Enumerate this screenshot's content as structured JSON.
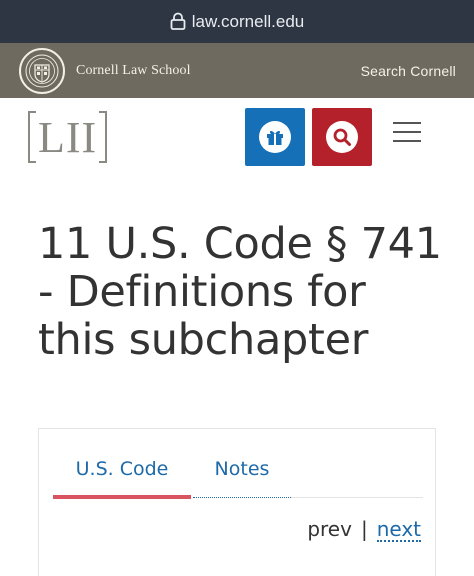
{
  "browser": {
    "url": "law.cornell.edu",
    "lock_icon": "lock-icon"
  },
  "cornell_bar": {
    "school_name": "Cornell Law School",
    "search_label": "Search Cornell",
    "background": "#6f6a5f"
  },
  "lii_header": {
    "logo_text": "LII",
    "give_button_icon": "gift-icon",
    "give_button_color": "#1670b8",
    "search_button_icon": "search-icon",
    "search_button_color": "#b4212b",
    "menu_icon": "hamburger-menu-icon"
  },
  "page": {
    "title": "11 U.S. Code § 741 - Definitions for this subchapter"
  },
  "tabs": [
    {
      "label": "U.S. Code",
      "active": true
    },
    {
      "label": "Notes",
      "active": false
    }
  ],
  "pager": {
    "prev": "prev",
    "separator": "|",
    "next": "next"
  }
}
